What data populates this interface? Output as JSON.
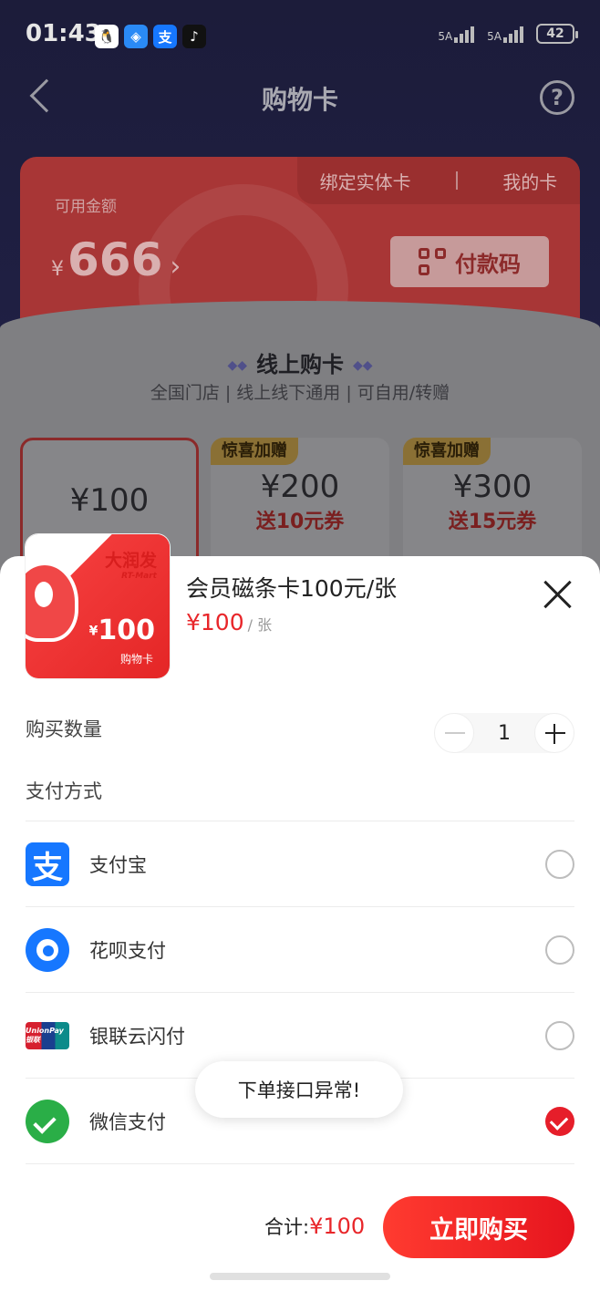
{
  "status_bar": {
    "time": "01:43",
    "apps": [
      {
        "icon": "qq-icon",
        "glyph": "🐧",
        "color": "#ffffff"
      },
      {
        "icon": "browser-icon",
        "glyph": "◈",
        "color": "#2a8af6"
      },
      {
        "icon": "alipay-app-icon",
        "glyph": "支",
        "color": "#1677ff"
      },
      {
        "icon": "tiktok-icon",
        "glyph": "♪",
        "color": "#111111"
      }
    ],
    "signal_1_label": "5A",
    "signal_2_label": "5A",
    "battery": "42"
  },
  "nav": {
    "title": "购物卡",
    "back_icon": "back-arrow-icon",
    "help_icon": "help-icon",
    "help_glyph": "?"
  },
  "balance_card": {
    "bind_physical_card": "绑定实体卡",
    "my_cards": "我的卡",
    "label": "可用金额",
    "currency": "¥",
    "amount": "666",
    "chevron": "›",
    "pay_code_button": "付款码"
  },
  "online_purchase": {
    "title": "线上购卡",
    "diamonds": "◆◆",
    "subtitle": "全国门店 | 线上线下通用 | 可自用/转赠",
    "options": [
      {
        "badge": "",
        "price": "¥100",
        "gift": "",
        "selected": true
      },
      {
        "badge": "惊喜加赠",
        "price": "¥200",
        "gift": "送10元券",
        "selected": false
      },
      {
        "badge": "惊喜加赠",
        "price": "¥300",
        "gift": "送15元券",
        "selected": false
      }
    ]
  },
  "sheet": {
    "product": {
      "thumb_brand": "大润发",
      "thumb_brand_en": "RT-Mart",
      "thumb_currency": "¥",
      "thumb_price": "100",
      "thumb_label": "购物卡",
      "name": "会员磁条卡100元/张",
      "price": "¥100",
      "unit": "/ 张"
    },
    "quantity": {
      "label": "购买数量",
      "value": "1"
    },
    "payment": {
      "label": "支付方式",
      "methods": [
        {
          "name": "支付宝",
          "icon": "alipay-icon",
          "glyph": "支",
          "selected": false
        },
        {
          "name": "花呗支付",
          "icon": "huabei-icon",
          "glyph": "",
          "selected": false
        },
        {
          "name": "银联云闪付",
          "icon": "unionpay-icon",
          "glyph": "UnionPay银联",
          "selected": false
        },
        {
          "name": "微信支付",
          "icon": "wechat-pay-icon",
          "glyph": "",
          "selected": true
        }
      ]
    },
    "toast": "下单接口异常!",
    "total_label": "合计:",
    "total_amount": "¥100",
    "buy_button": "立即购买"
  },
  "colors": {
    "accent_red": "#e8262a",
    "alipay_blue": "#1677ff",
    "wechat_green": "#2aae47"
  }
}
